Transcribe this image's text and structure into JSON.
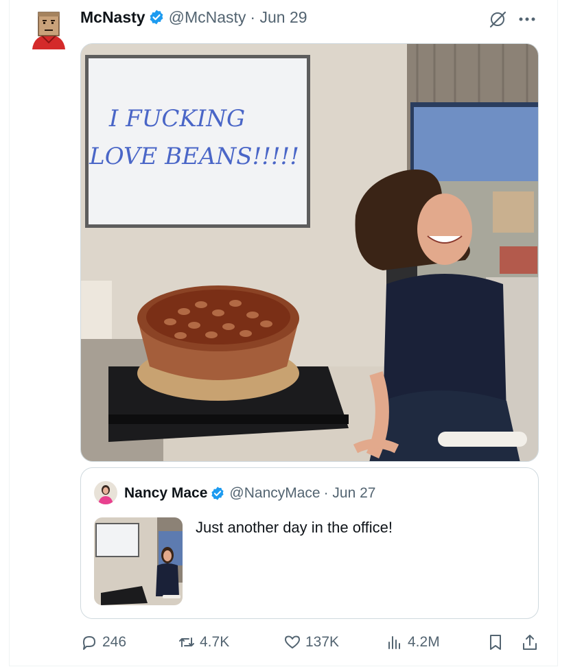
{
  "post": {
    "author_name": "McNasty",
    "author_handle": "@McNasty",
    "date": "· Jun 29",
    "image_text": [
      "I FUCKING",
      "LOVE BEANS!!!!!"
    ]
  },
  "quoted": {
    "author_name": "Nancy Mace",
    "author_handle": "@NancyMace",
    "date": "· Jun 27",
    "text": "Just another day in the office!"
  },
  "actions": {
    "replies": "246",
    "reposts": "4.7K",
    "likes": "137K",
    "views": "4.2M"
  },
  "colors": {
    "verified": "#1d9bf0",
    "secondary_text": "#536471",
    "border": "#cfd9de"
  },
  "icons": [
    "verified-badge-icon",
    "grok-icon",
    "more-icon",
    "reply-icon",
    "repost-icon",
    "like-icon",
    "views-icon",
    "bookmark-icon",
    "share-icon"
  ]
}
